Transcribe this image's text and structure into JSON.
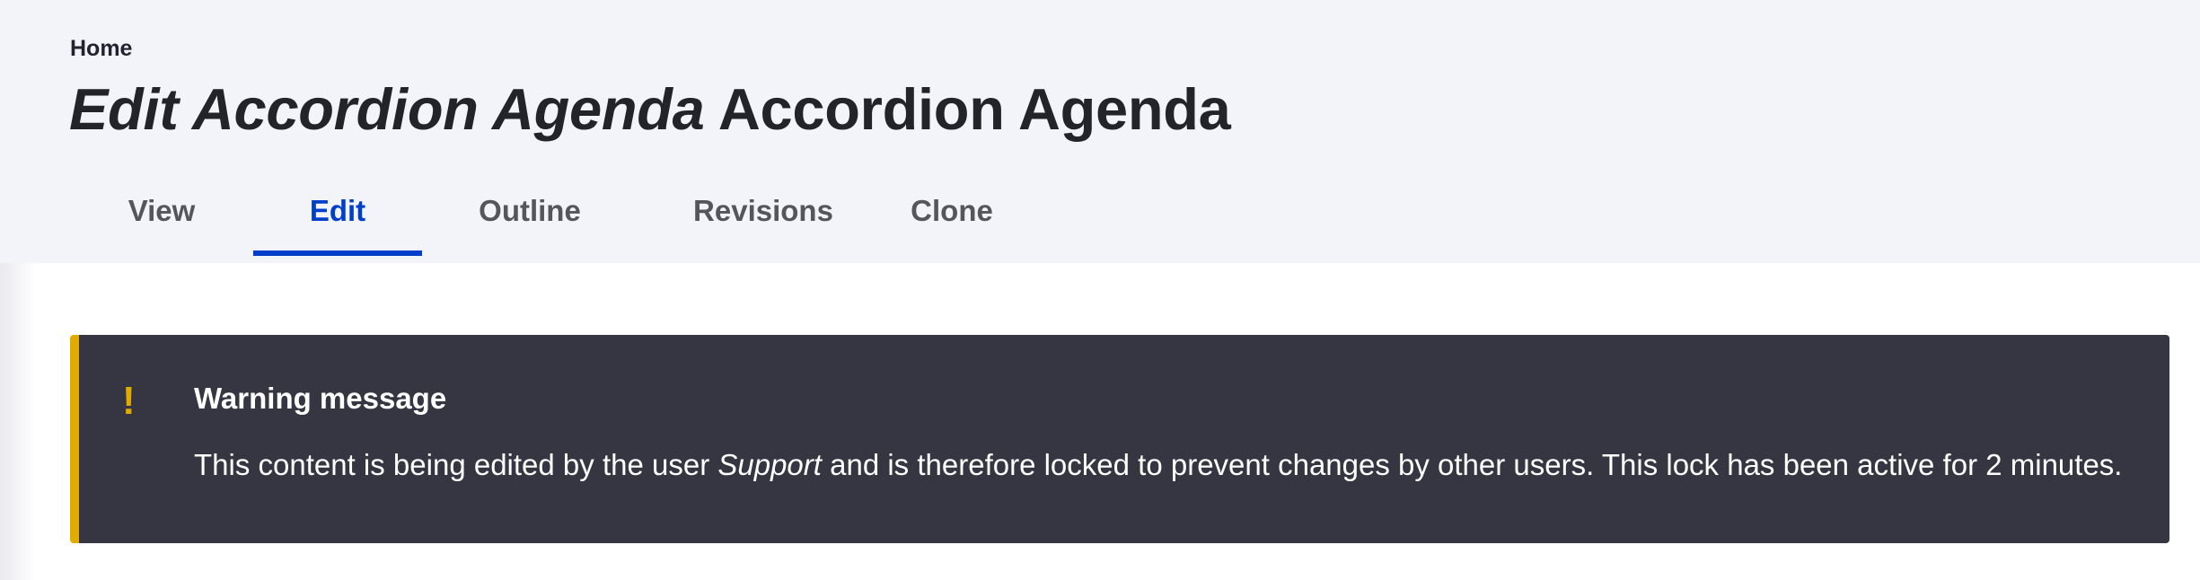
{
  "breadcrumb": {
    "home": "Home"
  },
  "page_title": {
    "prefix_italic": "Edit Accordion Agenda",
    "suffix": "Accordion Agenda"
  },
  "tabs": [
    {
      "label": "View",
      "active": false
    },
    {
      "label": "Edit",
      "active": true
    },
    {
      "label": "Outline",
      "active": false
    },
    {
      "label": "Revisions",
      "active": false
    },
    {
      "label": "Clone",
      "active": false
    }
  ],
  "warning": {
    "icon": "warning-exclamation-icon",
    "icon_glyph": "!",
    "title": "Warning message",
    "message_before": "This content is being edited by the user ",
    "message_user": "Support",
    "message_after": " and is therefore locked to prevent changes by other users. This lock has been active for 2 minutes."
  },
  "colors": {
    "header_bg": "#f3f4f9",
    "active_tab": "#003ecc",
    "warning_bg": "#353641",
    "warning_accent": "#e0ac00"
  }
}
